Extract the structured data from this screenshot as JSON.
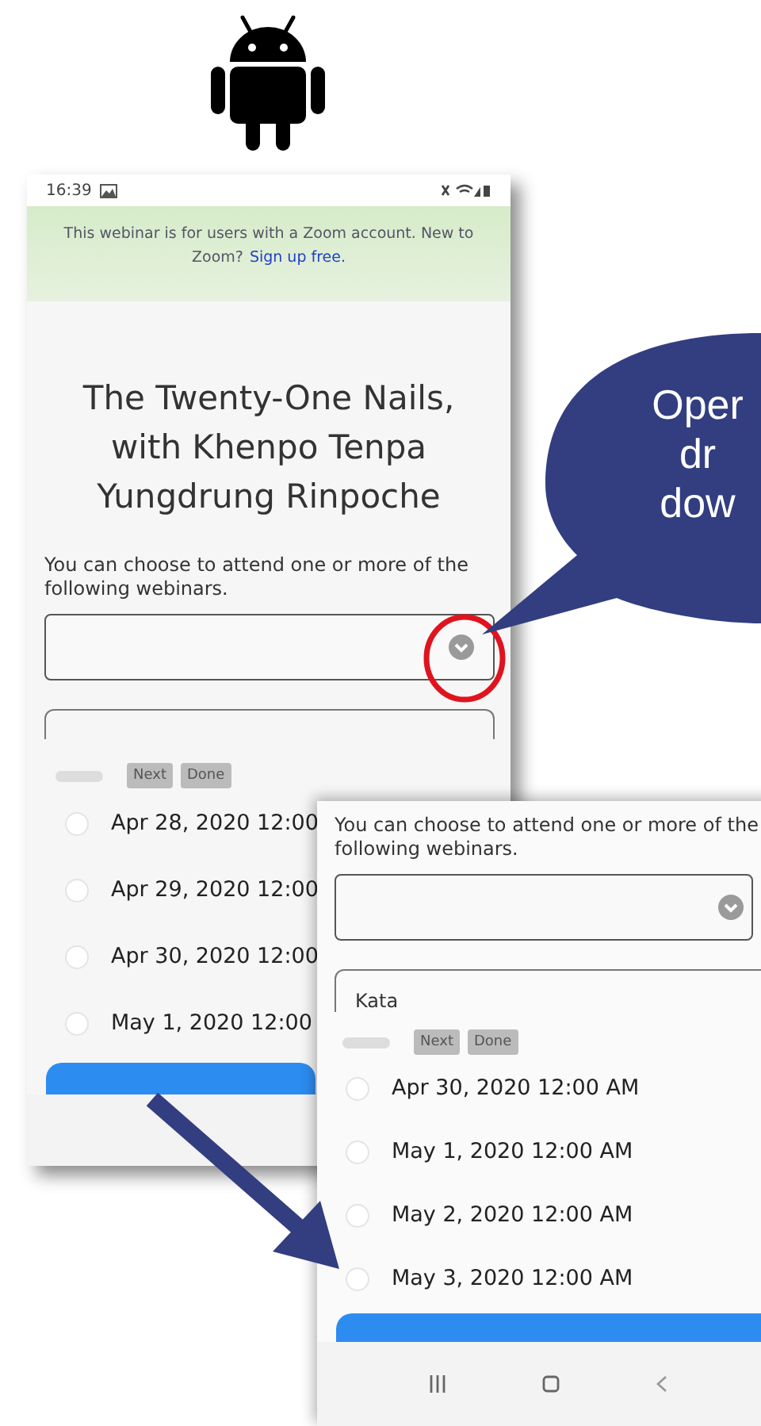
{
  "phone_main": {
    "status_bar": {
      "time": "16:39"
    },
    "banner": {
      "text": "This webinar is for users with a Zoom account. New to Zoom?",
      "link": "Sign up free."
    },
    "title_lines": [
      "The Twenty-One Nails,",
      "with Khenpo Tenpa",
      "Yungdrung Rinpoche"
    ],
    "prompt": "You can choose to attend one or more of the following webinars.",
    "keyboard_toolbar": {
      "buttons": [
        "Next",
        "Done"
      ]
    },
    "webinars": [
      {
        "label": "Apr 28, 2020 12:00",
        "checked": false
      },
      {
        "label": "Apr 29, 2020 12:00",
        "checked": false
      },
      {
        "label": "Apr 30, 2020 12:00",
        "checked": false
      },
      {
        "label": "May 1, 2020 12:00",
        "checked": false
      }
    ]
  },
  "phone_zoomed": {
    "prompt": "You can choose to attend one or more of the following webinars.",
    "second_field": {
      "value": "Kata"
    },
    "keyboard_toolbar": {
      "buttons": [
        "Next",
        "Done"
      ]
    },
    "webinars": [
      {
        "label": "Apr 30, 2020 12:00 AM",
        "checked": false
      },
      {
        "label": "May 1, 2020 12:00 AM",
        "checked": false
      },
      {
        "label": "May 2, 2020 12:00 AM",
        "checked": false
      },
      {
        "label": "May 3, 2020 12:00 AM",
        "checked": false
      }
    ]
  },
  "callout": {
    "lines": [
      "Oper",
      "dr",
      "dow"
    ]
  }
}
